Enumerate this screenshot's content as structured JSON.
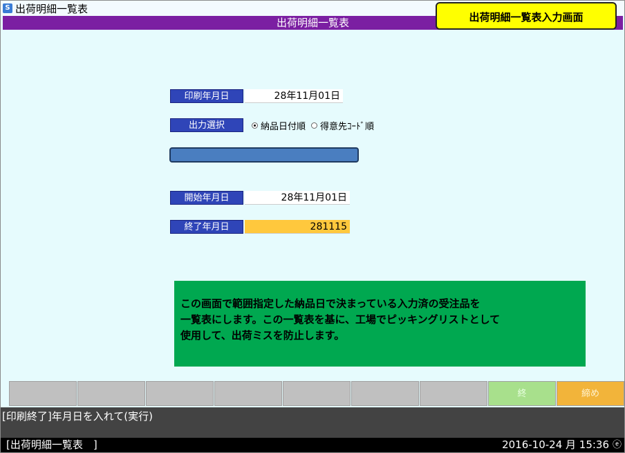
{
  "window": {
    "title": "出荷明細一覧表",
    "icon": "app-icon",
    "icon_glyph": "S"
  },
  "header": {
    "title": "出荷明細一覧表",
    "color": "#7b1fa2"
  },
  "callout": {
    "text": "出荷明細一覧表入力画面",
    "color": "#ffff00"
  },
  "form": {
    "print_date": {
      "label": "印刷年月日",
      "value": "28年11月01日"
    },
    "output_select": {
      "label": "出力選択",
      "options": [
        "納品日付順",
        "得意先ｺｰﾄﾞ順"
      ],
      "selected": "納品日付順"
    },
    "start_date": {
      "label": "開始年月日",
      "value": "28年11月01日"
    },
    "end_date": {
      "label": "終了年月日",
      "value": "281115",
      "highlight_color": "#ffc83d"
    }
  },
  "note": {
    "lines": [
      "この画面で範囲指定した納品日で決まっている入力済の受注品を",
      "一覧表にします。この一覧表を基に、工場でピッキングリストとして",
      "使用して、出荷ミスを防止します。"
    ],
    "color": "#00a850"
  },
  "function_keys": [
    "",
    "",
    "",
    "",
    "",
    "",
    "",
    "終",
    "締め"
  ],
  "status": {
    "message": "[印刷終了]年月日を入れて(実行)"
  },
  "bottom_bar": {
    "left": "[出荷明細一覧表　]",
    "right": "2016-10-24 月 15:36"
  }
}
